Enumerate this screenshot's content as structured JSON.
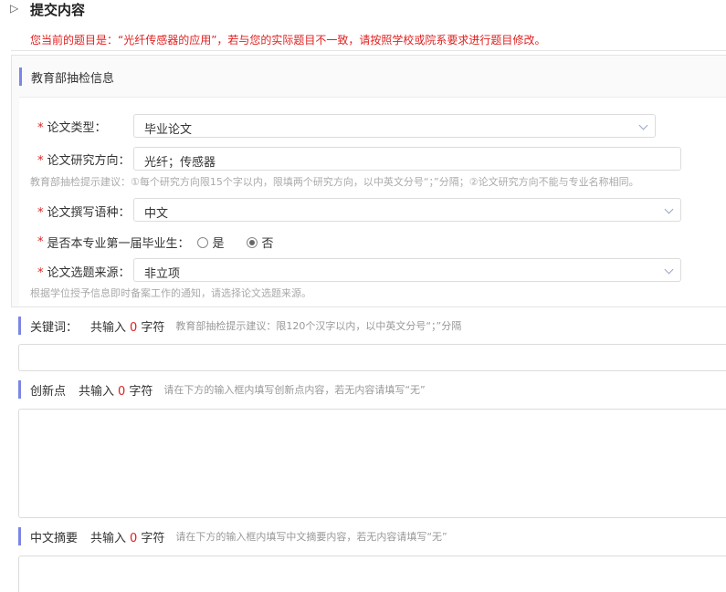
{
  "header": {
    "expand_icon": "▷",
    "title": "提交内容"
  },
  "notice": "您当前的题目是：“光纤传感器的应用”，若与您的实际题目不一致，请按照学校或院系要求进行题目修改。",
  "moe_section": {
    "title": "教育部抽检信息",
    "required_mark": "*",
    "thesis_type": {
      "label": "论文类型：",
      "value": "毕业论文"
    },
    "research_direction": {
      "label": "论文研究方向：",
      "value": "光纤；传感器",
      "hint": "教育部抽检提示建议：①每个研究方向限15个字以内，限填两个研究方向，以中英文分号“；”分隔；②论文研究方向不能与专业名称相同。"
    },
    "language": {
      "label": "论文撰写语种：",
      "value": "中文"
    },
    "first_graduate": {
      "label": "是否本专业第一届毕业生：",
      "options": [
        "是",
        "否"
      ],
      "selected": "否"
    },
    "topic_source": {
      "label": "论文选题来源：",
      "value": "非立项",
      "hint": "根据学位授予信息即时备案工作的通知，请选择论文选题来源。"
    }
  },
  "keywords": {
    "label": "关键词：",
    "count_prefix": "共输入",
    "count": "0",
    "count_suffix": "字符",
    "hint": "教育部抽检提示建议：限120个汉字以内，以中英文分号“；”分隔"
  },
  "innovation": {
    "label": "创新点",
    "count_prefix": "共输入",
    "count": "0",
    "count_suffix": "字符",
    "hint": "请在下方的输入框内填写创新点内容，若无内容请填写“无”"
  },
  "abstract_cn": {
    "label": "中文摘要",
    "count_prefix": "共输入",
    "count": "0",
    "count_suffix": "字符",
    "hint": "请在下方的输入框内填写中文摘要内容，若无内容请填写“无”"
  },
  "colors": {
    "accent_bar": "#7b86e6",
    "required": "#e02020",
    "notice": "#e02020"
  }
}
